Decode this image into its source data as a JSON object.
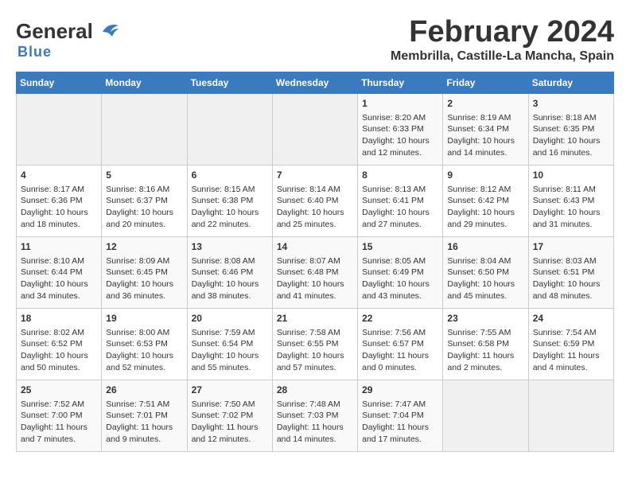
{
  "header": {
    "logo_general": "General",
    "logo_blue": "Blue",
    "month_year": "February 2024",
    "location": "Membrilla, Castille-La Mancha, Spain"
  },
  "days_of_week": [
    "Sunday",
    "Monday",
    "Tuesday",
    "Wednesday",
    "Thursday",
    "Friday",
    "Saturday"
  ],
  "weeks": [
    {
      "days": [
        {
          "num": "",
          "empty": true
        },
        {
          "num": "",
          "empty": true
        },
        {
          "num": "",
          "empty": true
        },
        {
          "num": "",
          "empty": true
        },
        {
          "num": "1",
          "sunrise": "8:20 AM",
          "sunset": "6:33 PM",
          "daylight": "10 hours and 12 minutes."
        },
        {
          "num": "2",
          "sunrise": "8:19 AM",
          "sunset": "6:34 PM",
          "daylight": "10 hours and 14 minutes."
        },
        {
          "num": "3",
          "sunrise": "8:18 AM",
          "sunset": "6:35 PM",
          "daylight": "10 hours and 16 minutes."
        }
      ]
    },
    {
      "days": [
        {
          "num": "4",
          "sunrise": "8:17 AM",
          "sunset": "6:36 PM",
          "daylight": "10 hours and 18 minutes."
        },
        {
          "num": "5",
          "sunrise": "8:16 AM",
          "sunset": "6:37 PM",
          "daylight": "10 hours and 20 minutes."
        },
        {
          "num": "6",
          "sunrise": "8:15 AM",
          "sunset": "6:38 PM",
          "daylight": "10 hours and 22 minutes."
        },
        {
          "num": "7",
          "sunrise": "8:14 AM",
          "sunset": "6:40 PM",
          "daylight": "10 hours and 25 minutes."
        },
        {
          "num": "8",
          "sunrise": "8:13 AM",
          "sunset": "6:41 PM",
          "daylight": "10 hours and 27 minutes."
        },
        {
          "num": "9",
          "sunrise": "8:12 AM",
          "sunset": "6:42 PM",
          "daylight": "10 hours and 29 minutes."
        },
        {
          "num": "10",
          "sunrise": "8:11 AM",
          "sunset": "6:43 PM",
          "daylight": "10 hours and 31 minutes."
        }
      ]
    },
    {
      "days": [
        {
          "num": "11",
          "sunrise": "8:10 AM",
          "sunset": "6:44 PM",
          "daylight": "10 hours and 34 minutes."
        },
        {
          "num": "12",
          "sunrise": "8:09 AM",
          "sunset": "6:45 PM",
          "daylight": "10 hours and 36 minutes."
        },
        {
          "num": "13",
          "sunrise": "8:08 AM",
          "sunset": "6:46 PM",
          "daylight": "10 hours and 38 minutes."
        },
        {
          "num": "14",
          "sunrise": "8:07 AM",
          "sunset": "6:48 PM",
          "daylight": "10 hours and 41 minutes."
        },
        {
          "num": "15",
          "sunrise": "8:05 AM",
          "sunset": "6:49 PM",
          "daylight": "10 hours and 43 minutes."
        },
        {
          "num": "16",
          "sunrise": "8:04 AM",
          "sunset": "6:50 PM",
          "daylight": "10 hours and 45 minutes."
        },
        {
          "num": "17",
          "sunrise": "8:03 AM",
          "sunset": "6:51 PM",
          "daylight": "10 hours and 48 minutes."
        }
      ]
    },
    {
      "days": [
        {
          "num": "18",
          "sunrise": "8:02 AM",
          "sunset": "6:52 PM",
          "daylight": "10 hours and 50 minutes."
        },
        {
          "num": "19",
          "sunrise": "8:00 AM",
          "sunset": "6:53 PM",
          "daylight": "10 hours and 52 minutes."
        },
        {
          "num": "20",
          "sunrise": "7:59 AM",
          "sunset": "6:54 PM",
          "daylight": "10 hours and 55 minutes."
        },
        {
          "num": "21",
          "sunrise": "7:58 AM",
          "sunset": "6:55 PM",
          "daylight": "10 hours and 57 minutes."
        },
        {
          "num": "22",
          "sunrise": "7:56 AM",
          "sunset": "6:57 PM",
          "daylight": "11 hours and 0 minutes."
        },
        {
          "num": "23",
          "sunrise": "7:55 AM",
          "sunset": "6:58 PM",
          "daylight": "11 hours and 2 minutes."
        },
        {
          "num": "24",
          "sunrise": "7:54 AM",
          "sunset": "6:59 PM",
          "daylight": "11 hours and 4 minutes."
        }
      ]
    },
    {
      "days": [
        {
          "num": "25",
          "sunrise": "7:52 AM",
          "sunset": "7:00 PM",
          "daylight": "11 hours and 7 minutes."
        },
        {
          "num": "26",
          "sunrise": "7:51 AM",
          "sunset": "7:01 PM",
          "daylight": "11 hours and 9 minutes."
        },
        {
          "num": "27",
          "sunrise": "7:50 AM",
          "sunset": "7:02 PM",
          "daylight": "11 hours and 12 minutes."
        },
        {
          "num": "28",
          "sunrise": "7:48 AM",
          "sunset": "7:03 PM",
          "daylight": "11 hours and 14 minutes."
        },
        {
          "num": "29",
          "sunrise": "7:47 AM",
          "sunset": "7:04 PM",
          "daylight": "11 hours and 17 minutes."
        },
        {
          "num": "",
          "empty": true
        },
        {
          "num": "",
          "empty": true
        }
      ]
    }
  ]
}
